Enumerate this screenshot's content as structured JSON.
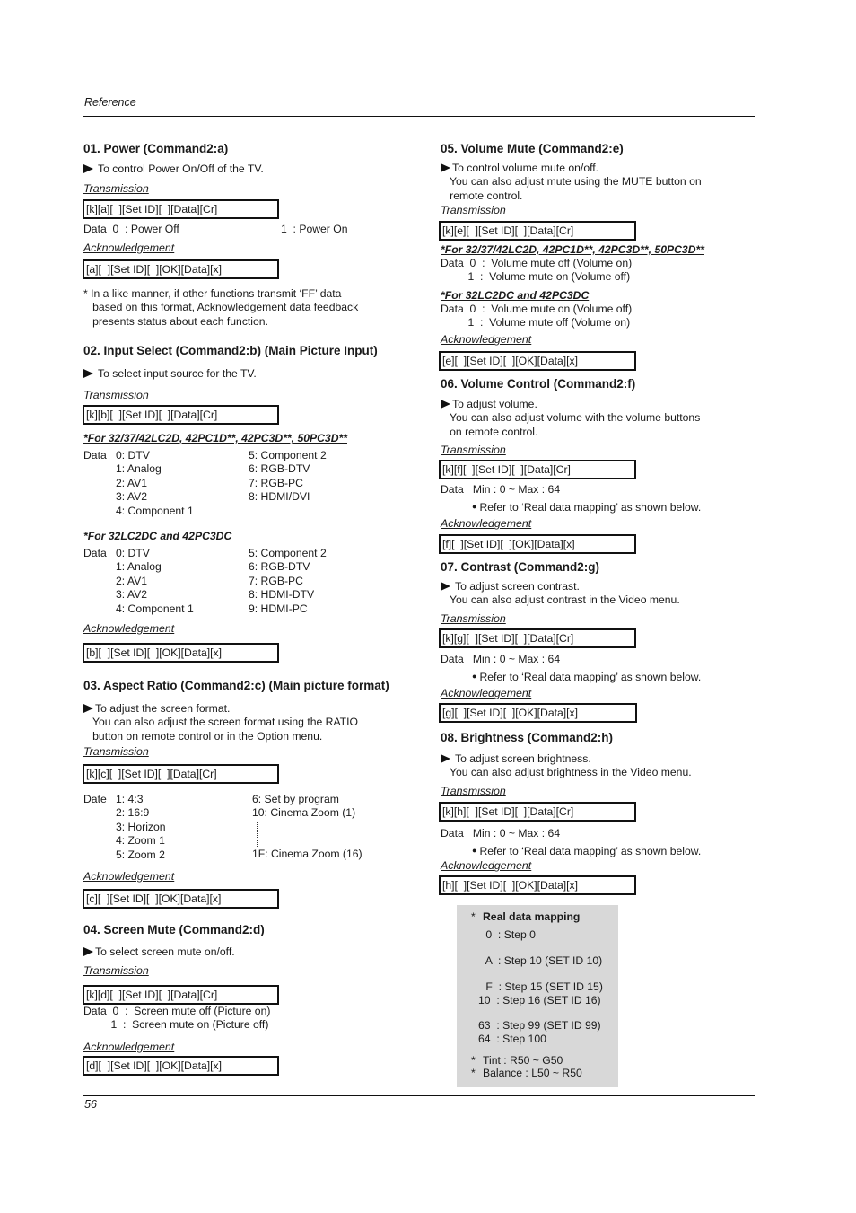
{
  "header": {
    "section": "Reference",
    "page_number": "56"
  },
  "labels": {
    "transmission": "Transmission",
    "acknowledgement": "Acknowledgement",
    "data": "Data",
    "date": "Date"
  },
  "s01": {
    "title": "01. Power (Command2:a)",
    "desc": "To control Power On/Off of the TV.",
    "tx": "[k][a][  ][Set ID][  ][Data][Cr]",
    "data0": "Data  0  : Power Off",
    "data1": "1  : Power On",
    "ack": "[a][  ][Set ID][  ][OK][Data][x]",
    "note": "* In a like manner, if other functions transmit ‘FF’ data\n   based on this format, Acknowledgement data feedback\n   presents status about each function."
  },
  "s02": {
    "title": "02. Input Select (Command2:b) (Main Picture Input)",
    "desc": "To select input source for the TV.",
    "tx": "[k][b][  ][Set ID][  ][Data][Cr]",
    "modelsA": "*For 32/37/42LC2D, 42PC1D**, 42PC3D**, 50PC3D**",
    "listA_left": "0: DTV\n1: Analog\n2: AV1\n3: AV2\n4: Component 1",
    "listA_right": "5: Component 2\n6: RGB-DTV\n7: RGB-PC\n8: HDMI/DVI",
    "modelsB": "*For 32LC2DC and 42PC3DC",
    "listB_left": "0: DTV\n1: Analog\n2: AV1\n3: AV2\n4: Component 1",
    "listB_right": "5: Component 2\n6: RGB-DTV\n7: RGB-PC\n8: HDMI-DTV\n9: HDMI-PC",
    "ack": "[b][  ][Set ID][  ][OK][Data][x]"
  },
  "s03": {
    "title": "03. Aspect Ratio (Command2:c) (Main picture format)",
    "desc": "To adjust the screen format.\n   You can also adjust the screen format using the RATIO\n   button on remote control or in the Option menu.",
    "tx": "[k][c][  ][Set ID][  ][Data][Cr]",
    "list_left": "1: 4:3\n2: 16:9\n3: Horizon\n4: Zoom 1\n5: Zoom 2",
    "list_right_top": "6: Set by program\n10: Cinema Zoom (1)",
    "list_right_bottom": "1F: Cinema Zoom (16)",
    "ack": "[c][  ][Set ID][  ][OK][Data][x]"
  },
  "s04": {
    "title": "04. Screen Mute (Command2:d)",
    "desc": "To select screen mute on/off.",
    "tx": "[k][d][  ][Set ID][  ][Data][Cr]",
    "data": "Data  0  :  Screen mute off (Picture on)\n         1  :  Screen mute on (Picture off)",
    "ack": "[d][  ][Set ID][  ][OK][Data][x]"
  },
  "s05": {
    "title": "05. Volume Mute (Command2:e)",
    "desc": "To control volume mute on/off.\n   You can also adjust mute using the MUTE button on\n   remote control.",
    "tx": "[k][e][  ][Set ID][  ][Data][Cr]",
    "modelsA": "*For 32/37/42LC2D, 42PC1D**, 42PC3D**, 50PC3D**",
    "dataA": "Data  0  :  Volume mute off (Volume on)\n         1  :  Volume mute on (Volume off)",
    "modelsB": "*For 32LC2DC and 42PC3DC",
    "dataB": "Data  0  :  Volume mute on (Volume off)\n         1  :  Volume mute off (Volume on)",
    "ack": "[e][  ][Set ID][  ][OK][Data][x]"
  },
  "s06": {
    "title": "06. Volume Control (Command2:f)",
    "desc": "To adjust volume.\n   You can also adjust volume with the volume buttons\n   on remote control.",
    "tx": "[k][f][  ][Set ID][  ][Data][Cr]",
    "range": "Data   Min : 0 ~ Max : 64",
    "refer": "Refer to ‘Real data mapping’ as shown below.",
    "ack": "[f][  ][Set ID][  ][OK][Data][x]"
  },
  "s07": {
    "title": "07. Contrast (Command2:g)",
    "desc": "To adjust screen contrast.\n   You can also adjust contrast in the Video menu.",
    "tx": "[k][g][  ][Set ID][  ][Data][Cr]",
    "range": "Data   Min : 0 ~ Max : 64",
    "refer": "Refer to ‘Real data mapping’ as shown below.",
    "ack": "[g][  ][Set ID][  ][OK][Data][x]"
  },
  "s08": {
    "title": "08. Brightness (Command2:h)",
    "desc": "To adjust screen brightness.\n   You can also adjust brightness in the Video menu.",
    "tx": "[k][h][  ][Set ID][  ][Data][Cr]",
    "range": "Data   Min : 0 ~ Max : 64",
    "refer": "Refer to ‘Real data mapping’ as shown below.",
    "ack": "[h][  ][Set ID][  ][OK][Data][x]"
  },
  "mapping": {
    "title": "Real data mapping",
    "rows": [
      " 0  : Step 0",
      " A  : Step 10 (SET ID 10)",
      " F  : Step 15 (SET ID 15)",
      "10  : Step 16 (SET ID 16)",
      "63  : Step 99 (SET ID 99)",
      "64  : Step 100"
    ],
    "tint": "Tint : R50 ~ G50",
    "balance": "Balance : L50 ~ R50",
    "bg_color": "#d8d8d8"
  }
}
